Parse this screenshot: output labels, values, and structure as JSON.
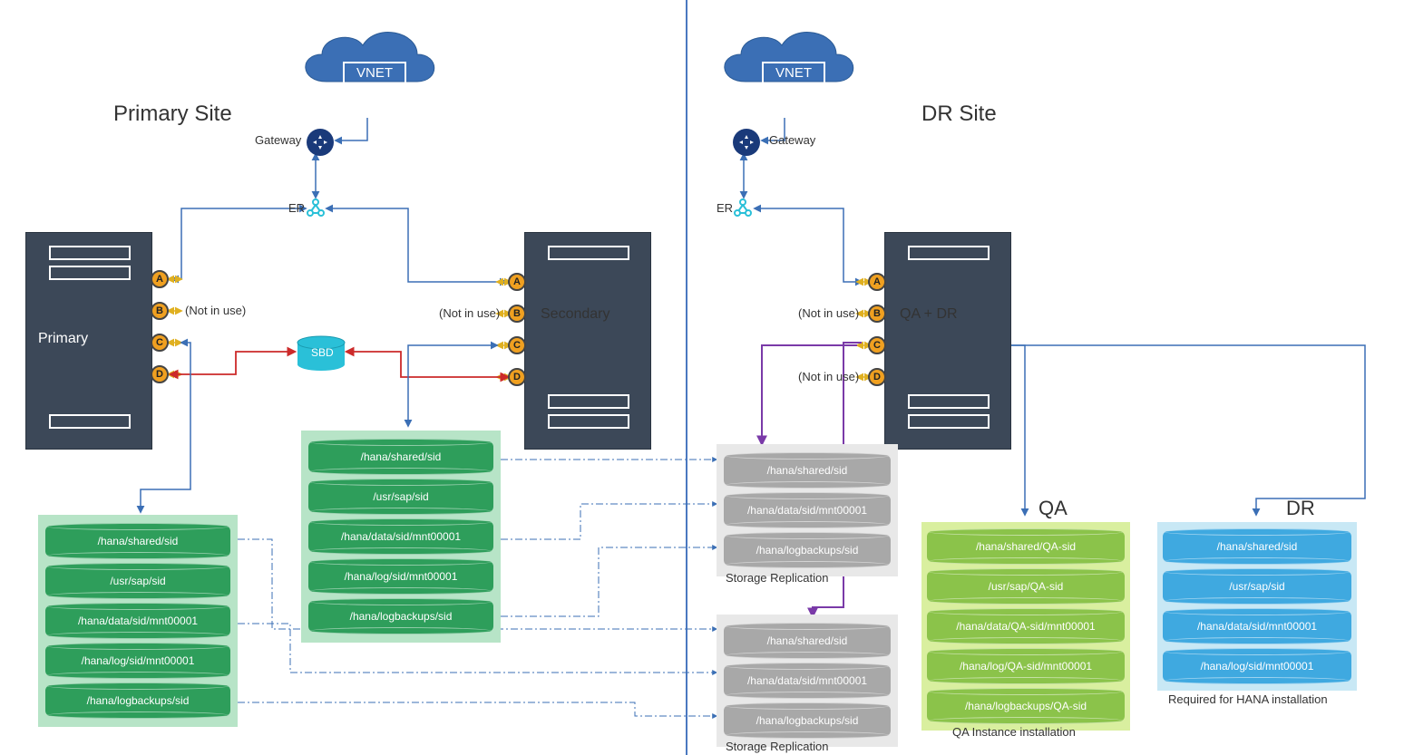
{
  "titles": {
    "primary": "Primary Site",
    "dr": "DR Site"
  },
  "vnet": "VNET",
  "gateway": "Gateway",
  "er": "ER",
  "ports": {
    "a": "A",
    "b": "B",
    "c": "C",
    "d": "D"
  },
  "not_in_use": "(Not in use)",
  "servers": {
    "primary": "Primary",
    "secondary": "Secondary",
    "qadr": "QA + DR"
  },
  "sbd": "SBD",
  "storage_primary": [
    "/hana/shared/sid",
    "/usr/sap/sid",
    "/hana/data/sid/mnt00001",
    "/hana/log/sid/mnt00001",
    "/hana/logbackups/sid"
  ],
  "storage_secondary": [
    "/hana/shared/sid",
    "/usr/sap/sid",
    "/hana/data/sid/mnt00001",
    "/hana/log/sid/mnt00001",
    "/hana/logbackups/sid"
  ],
  "repl1": [
    "/hana/shared/sid",
    "/hana/data/sid/mnt00001",
    "/hana/logbackups/sid"
  ],
  "repl2": [
    "/hana/shared/sid",
    "/hana/data/sid/mnt00001",
    "/hana/logbackups/sid"
  ],
  "storage_replication": "Storage Replication",
  "qa_label": "QA",
  "qa_disks": [
    "/hana/shared/QA-sid",
    "/usr/sap/QA-sid",
    "/hana/data/QA-sid/mnt00001",
    "/hana/log/QA-sid/mnt00001",
    "/hana/logbackups/QA-sid"
  ],
  "qa_caption": "QA Instance installation",
  "dr_label": "DR",
  "dr_disks": [
    "/hana/shared/sid",
    "/usr/sap/sid",
    "/hana/data/sid/mnt00001",
    "/hana/log/sid/mnt00001"
  ],
  "dr_caption": "Required for HANA installation"
}
